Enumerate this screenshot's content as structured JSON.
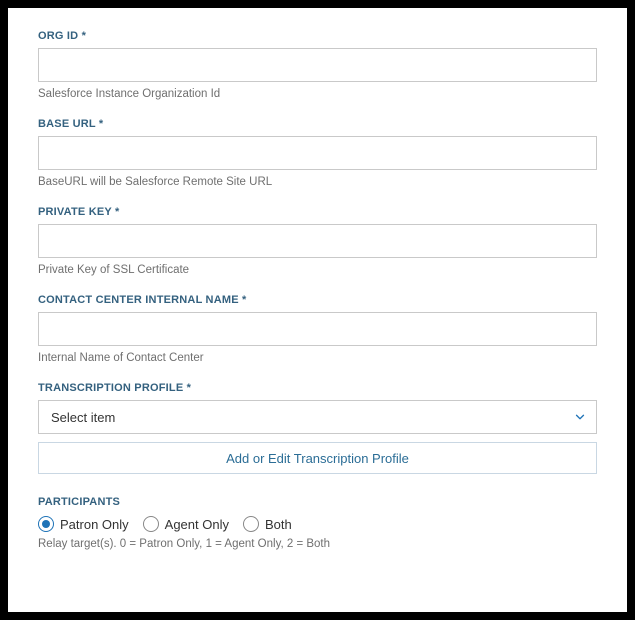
{
  "fields": {
    "orgId": {
      "label": "ORG ID",
      "required": "*",
      "value": "",
      "help": "Salesforce Instance Organization Id"
    },
    "baseUrl": {
      "label": "BASE URL",
      "required": "*",
      "value": "",
      "help": "BaseURL will be Salesforce Remote Site URL"
    },
    "privateKey": {
      "label": "PRIVATE KEY",
      "required": "*",
      "value": "",
      "help": "Private Key of SSL Certificate"
    },
    "contactCenter": {
      "label": "CONTACT CENTER INTERNAL NAME",
      "required": "*",
      "value": "",
      "help": "Internal Name of Contact Center"
    },
    "transcriptionProfile": {
      "label": "TRANSCRIPTION PROFILE",
      "required": "*",
      "selected": "Select item",
      "buttonLabel": "Add or Edit Transcription Profile"
    }
  },
  "participants": {
    "label": "PARTICIPANTS",
    "options": [
      {
        "label": "Patron Only",
        "selected": true
      },
      {
        "label": "Agent Only",
        "selected": false
      },
      {
        "label": "Both",
        "selected": false
      }
    ],
    "help": "Relay target(s). 0 = Patron Only, 1 = Agent Only, 2 = Both"
  }
}
